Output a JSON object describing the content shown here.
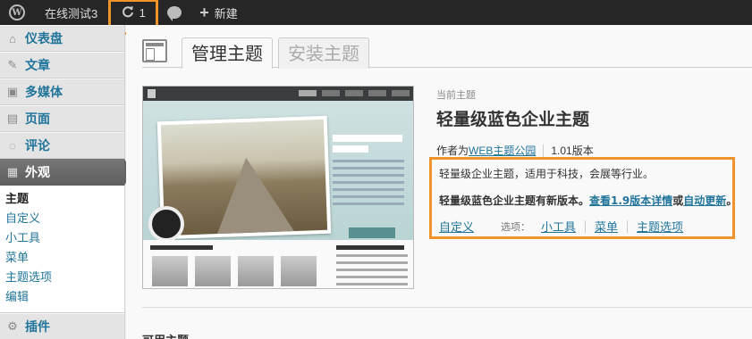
{
  "adminbar": {
    "site_name": "在线测试3",
    "updates_count": "1",
    "new_label": "新建"
  },
  "sidebar": {
    "items": [
      {
        "label": "仪表盘",
        "icon": "home-icon"
      },
      {
        "label": "文章",
        "icon": "pin-icon"
      },
      {
        "label": "多媒体",
        "icon": "media-icon"
      },
      {
        "label": "页面",
        "icon": "page-icon"
      },
      {
        "label": "评论",
        "icon": "comment-icon"
      },
      {
        "label": "外观",
        "icon": "appearance-icon"
      }
    ],
    "submenu": [
      "主题",
      "自定义",
      "小工具",
      "菜单",
      "主题选项",
      "编辑"
    ],
    "after": {
      "label": "插件",
      "icon": "plugin-icon"
    }
  },
  "tabs": {
    "manage": "管理主题",
    "install": "安装主题"
  },
  "theme": {
    "current_label": "当前主题",
    "name": "轻量级蓝色企业主题",
    "author_prefix": "作者为",
    "author_link": "WEB主题公园",
    "version": "1.01版本",
    "description": "轻量级企业主题，适用于科技，会展等行业。",
    "update_text_1": "轻量级蓝色企业主题有新版本。",
    "update_link_1": "查看1.9版本详情",
    "update_text_2": "或",
    "update_link_2": "自动更新",
    "update_text_3": "。",
    "customize": "自定义",
    "options_label": "选项：",
    "option_links": [
      "小工具",
      "菜单",
      "主题选项"
    ]
  },
  "below": {
    "heading_partial": "可用主题"
  },
  "colors": {
    "accent_highlight": "#f0932b",
    "link": "#21759b",
    "adminbar_bg": "#262626"
  }
}
